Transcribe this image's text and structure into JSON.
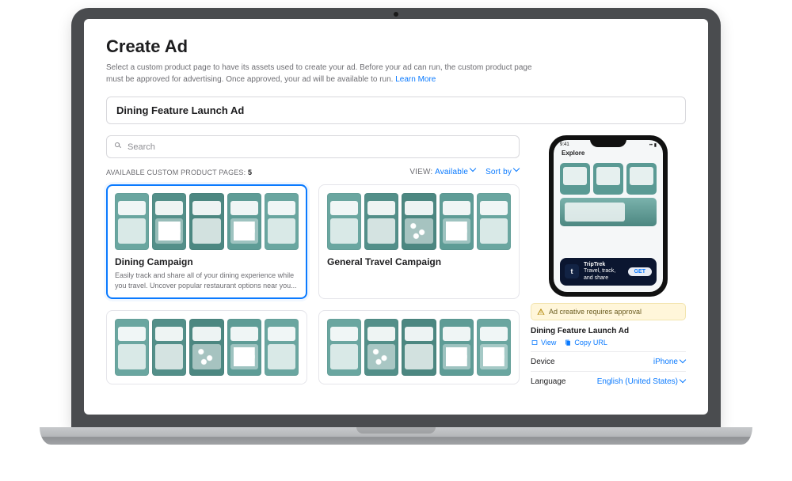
{
  "header": {
    "title": "Create Ad",
    "description": "Select a custom product page to have its assets used to create your ad. Before your ad can run, the custom product page must be approved for advertising. Once approved, your ad will be available to run.",
    "learn_more": "Learn More"
  },
  "ad_name_field": "Dining Feature Launch Ad",
  "search": {
    "placeholder": "Search"
  },
  "list_header": {
    "label": "AVAILABLE CUSTOM PRODUCT PAGES:",
    "count": "5",
    "view_label": "VIEW:",
    "view_value": "Available",
    "sort_label": "Sort by"
  },
  "cards": [
    {
      "title": "Dining Campaign",
      "subtitle": "Easily track and share all of your dining experience while you travel. Uncover popular restaurant options near you...",
      "selected": true
    },
    {
      "title": "General Travel Campaign",
      "subtitle": "",
      "selected": false
    },
    {
      "title": "",
      "subtitle": "",
      "selected": false
    },
    {
      "title": "",
      "subtitle": "",
      "selected": false
    }
  ],
  "preview": {
    "status_time": "9:41",
    "hero_heading": "Explore",
    "app_name": "TripTrek",
    "app_tagline": "Travel, track, and share",
    "get_label": "GET",
    "approval_notice": "Ad creative requires approval",
    "name": "Dining Feature Launch Ad",
    "actions": {
      "view": "View",
      "copy": "Copy URL"
    },
    "settings": {
      "device_label": "Device",
      "device_value": "iPhone",
      "language_label": "Language",
      "language_value": "English (United States)"
    }
  }
}
